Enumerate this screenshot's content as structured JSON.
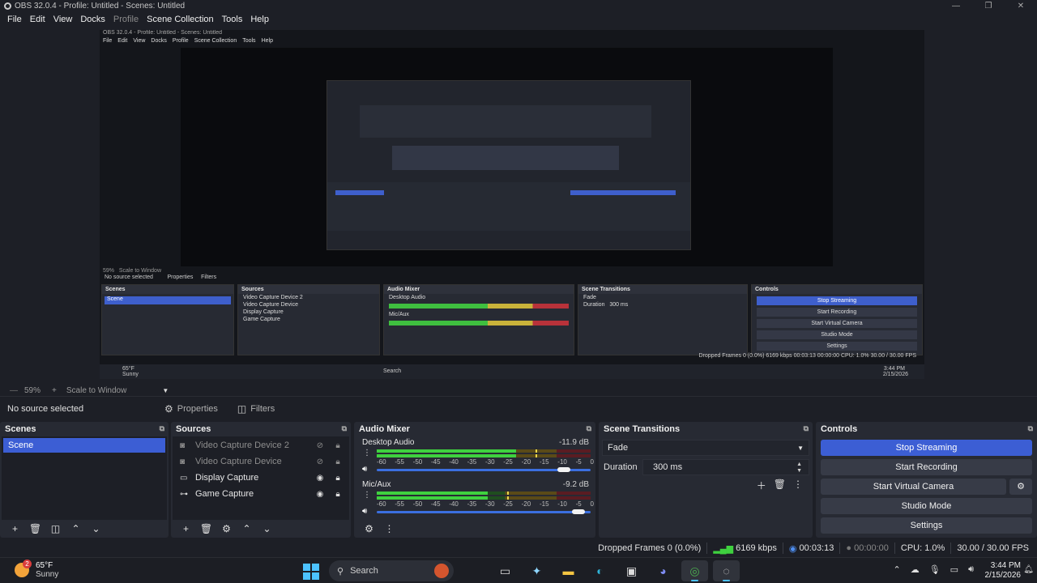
{
  "window": {
    "title": "OBS 32.0.4 - Profile: Untitled - Scenes: Untitled",
    "controls": [
      "—",
      "❐",
      "✕"
    ]
  },
  "menu": [
    "File",
    "Edit",
    "View",
    "Docks",
    "Profile",
    "Scene Collection",
    "Tools",
    "Help"
  ],
  "nested_preview": {
    "title": "OBS 32.0.4 - Profile: Untitled - Scenes: Untitled",
    "menu": [
      "File",
      "Edit",
      "View",
      "Docks",
      "Profile",
      "Scene Collection",
      "Tools",
      "Help"
    ],
    "docks": {
      "scenes": "Scenes",
      "scene": "Scene",
      "sources": "Sources",
      "audio": "Audio Mixer",
      "transitions": "Scene Transitions",
      "controls": "Controls",
      "sources_list": [
        "Video Capture Device 2",
        "Video Capture Device",
        "Display Capture",
        "Game Capture"
      ],
      "buttons": [
        "Stop Streaming",
        "Start Recording",
        "Start Virtual Camera",
        "Studio Mode",
        "Settings"
      ],
      "fade": "Fade",
      "duration": "Duration",
      "duration_value": "300 ms",
      "desktop_audio": "Desktop Audio",
      "mic": "Mic/Aux"
    },
    "no_source": "No source selected",
    "properties": "Properties",
    "filters": "Filters",
    "scale": "59%",
    "scale_mode": "Scale to Window",
    "status": "Dropped Frames 0 (0.0%)   6169 kbps   00:03:13   00:00:00   CPU: 1.0%   30.00 / 30.00 FPS",
    "weather_temp": "65°F",
    "weather_desc": "Sunny",
    "search": "Search",
    "time": "3:44 PM",
    "date": "2/15/2026"
  },
  "scalebar": {
    "zoom": "59%",
    "plus": "+",
    "mode": "Scale to Window"
  },
  "source_toolbar": {
    "no_source": "No source selected",
    "properties": "Properties",
    "filters": "Filters"
  },
  "scenes": {
    "title": "Scenes",
    "items": [
      "Scene"
    ]
  },
  "sources": {
    "title": "Sources",
    "items": [
      {
        "label": "Video Capture Device 2",
        "icon": "camera-icon",
        "visible": false
      },
      {
        "label": "Video Capture Device",
        "icon": "camera-icon",
        "visible": false
      },
      {
        "label": "Display Capture",
        "icon": "monitor-icon",
        "visible": true
      },
      {
        "label": "Game Capture",
        "icon": "gamepad-icon",
        "visible": true
      }
    ]
  },
  "audio_mixer": {
    "title": "Audio Mixer",
    "channels": [
      {
        "name": "Desktop Audio",
        "db": "-11.9 dB",
        "level": 0.65,
        "volume": 0.9
      },
      {
        "name": "Mic/Aux",
        "db": "-9.2 dB",
        "level": 0.52,
        "volume": 0.97
      }
    ],
    "scale": [
      "-60",
      "-55",
      "-50",
      "-45",
      "-40",
      "-35",
      "-30",
      "-25",
      "-20",
      "-15",
      "-10",
      "-5",
      "0"
    ]
  },
  "transitions": {
    "title": "Scene Transitions",
    "selected": "Fade",
    "duration_label": "Duration",
    "duration": "300 ms"
  },
  "controls": {
    "title": "Controls",
    "stop_streaming": "Stop Streaming",
    "start_recording": "Start Recording",
    "start_virtual_camera": "Start Virtual Camera",
    "studio_mode": "Studio Mode",
    "settings": "Settings"
  },
  "status": {
    "dropped": "Dropped Frames 0 (0.0%)",
    "bitrate": "6169 kbps",
    "stream_time": "00:03:13",
    "rec_time": "00:00:00",
    "cpu": "CPU: 1.0%",
    "fps": "30.00 / 30.00 FPS"
  },
  "taskbar": {
    "weather_temp": "65°F",
    "weather_desc": "Sunny",
    "weather_badge": "2",
    "search": "Search",
    "time": "3:44 PM",
    "date": "2/15/2026"
  }
}
